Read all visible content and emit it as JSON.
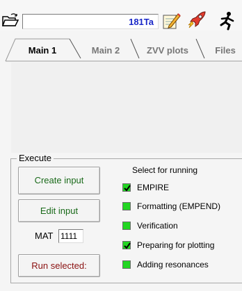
{
  "toolbar": {
    "project_value": "181Ta",
    "icons": [
      "open-folder-icon",
      "edit-notepad-icon",
      "rocket-icon",
      "running-man-icon"
    ]
  },
  "tabs": [
    {
      "label": "Main 1",
      "active": true
    },
    {
      "label": "Main 2",
      "active": false
    },
    {
      "label": "ZVV plots",
      "active": false
    },
    {
      "label": "Files",
      "active": false
    }
  ],
  "execute": {
    "legend": "Execute",
    "create_input": "Create input",
    "edit_input": "Edit input",
    "mat_label": "MAT",
    "mat_value": "1111",
    "run_selected": "Run selected:",
    "select_label": "Select for running",
    "options": [
      {
        "label": "EMPIRE",
        "checked": true
      },
      {
        "label": "Formatting (EMPEND)",
        "checked": false
      },
      {
        "label": "Verification",
        "checked": false
      },
      {
        "label": "Preparing for plotting",
        "checked": true
      },
      {
        "label": "Adding resonances",
        "checked": false
      }
    ]
  },
  "colors": {
    "checkbox_green": "#22d622",
    "project_text": "#1a28c8",
    "green_button_text": "#1a6a1a",
    "run_button_text": "#8a1010"
  }
}
